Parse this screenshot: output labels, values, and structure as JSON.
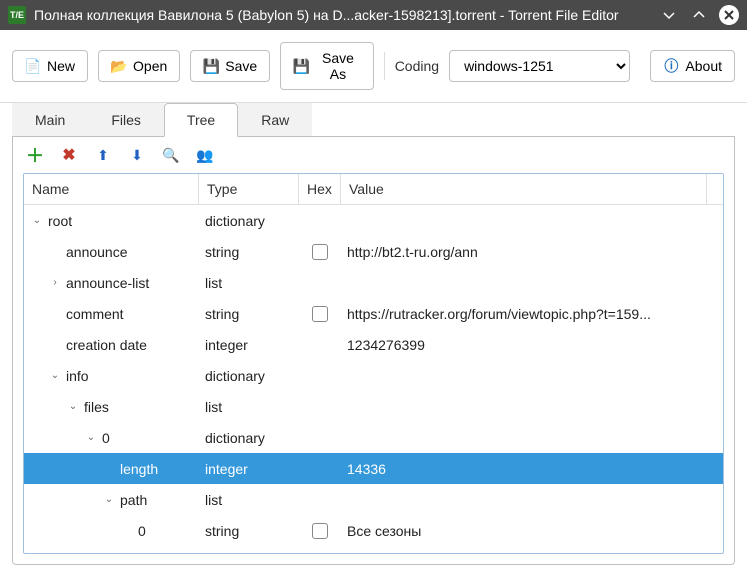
{
  "window": {
    "title": "Полная коллекция Вавилона 5 (Babylon 5) на D...acker-1598213].torrent - Torrent File Editor",
    "app_icon": "T/E"
  },
  "toolbar": {
    "new_label": "New",
    "open_label": "Open",
    "save_label": "Save",
    "saveas_label": "Save As",
    "coding_label": "Coding",
    "coding_value": "windows-1251",
    "about_label": "About"
  },
  "tabs": {
    "main": "Main",
    "files": "Files",
    "tree": "Tree",
    "raw": "Raw",
    "active": "tree"
  },
  "grid": {
    "headers": {
      "name": "Name",
      "type": "Type",
      "hex": "Hex",
      "value": "Value"
    },
    "rows": [
      {
        "depth": 0,
        "exp": "v",
        "name": "root",
        "type": "dictionary",
        "hex": null,
        "value": ""
      },
      {
        "depth": 1,
        "exp": "",
        "name": "announce",
        "type": "string",
        "hex": false,
        "value": "http://bt2.t-ru.org/ann"
      },
      {
        "depth": 1,
        "exp": ">",
        "name": "announce-list",
        "type": "list",
        "hex": null,
        "value": ""
      },
      {
        "depth": 1,
        "exp": "",
        "name": "comment",
        "type": "string",
        "hex": false,
        "value": "https://rutracker.org/forum/viewtopic.php?t=159..."
      },
      {
        "depth": 1,
        "exp": "",
        "name": "creation date",
        "type": "integer",
        "hex": null,
        "value": "1234276399"
      },
      {
        "depth": 1,
        "exp": "v",
        "name": "info",
        "type": "dictionary",
        "hex": null,
        "value": ""
      },
      {
        "depth": 2,
        "exp": "v",
        "name": "files",
        "type": "list",
        "hex": null,
        "value": ""
      },
      {
        "depth": 3,
        "exp": "v",
        "name": "0",
        "type": "dictionary",
        "hex": null,
        "value": ""
      },
      {
        "depth": 4,
        "exp": "",
        "name": "length",
        "type": "integer",
        "hex": null,
        "value": "14336",
        "selected": true
      },
      {
        "depth": 4,
        "exp": "v",
        "name": "path",
        "type": "list",
        "hex": null,
        "value": ""
      },
      {
        "depth": 5,
        "exp": "",
        "name": "0",
        "type": "string",
        "hex": false,
        "value": "Все сезоны"
      }
    ]
  }
}
